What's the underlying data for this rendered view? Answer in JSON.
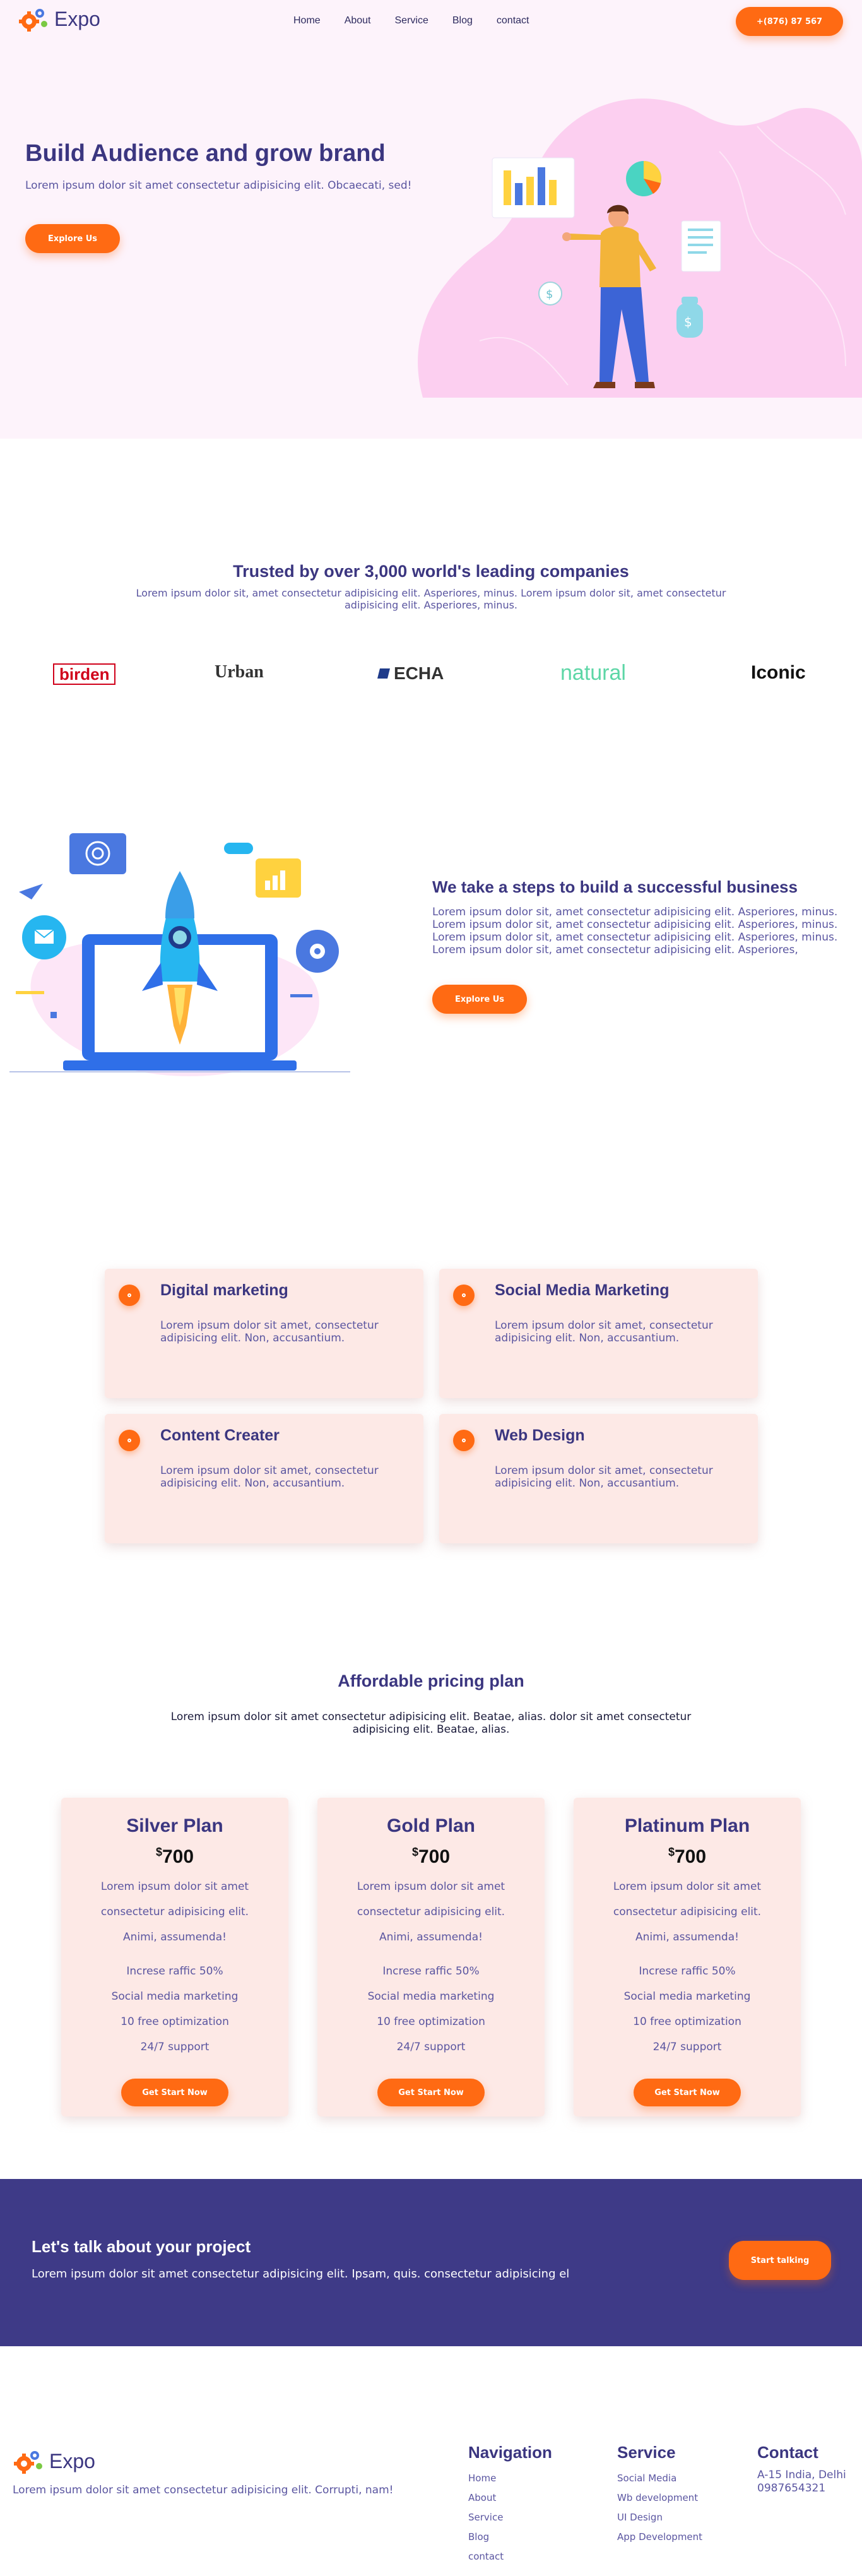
{
  "header": {
    "logo_text": "Expo",
    "nav": [
      "Home",
      "About",
      "Service",
      "Blog",
      "contact"
    ],
    "phone": "+(876) 87 567"
  },
  "hero": {
    "title": "Build Audience and grow brand",
    "subtitle": "Lorem ipsum dolor sit amet consectetur adipisicing elit. Obcaecati, sed!",
    "button": "Explore Us"
  },
  "trusted": {
    "title": "Trusted by over 3,000 world's leading companies",
    "subtitle": "Lorem ipsum dolor sit, amet consectetur adipisicing elit. Asperiores, minus. Lorem ipsum dolor sit, amet consectetur adipisicing elit. Asperiores, minus.",
    "brands": [
      "birden",
      "Urban",
      "ECHA",
      "natural",
      "Iconic"
    ]
  },
  "steps": {
    "title": "We take a steps to build a successful business",
    "text": "Lorem ipsum dolor sit, amet consectetur adipisicing elit. Asperiores, minus. Lorem ipsum dolor sit, amet consectetur adipisicing elit. Asperiores, minus. Lorem ipsum dolor sit, amet consectetur adipisicing elit. Asperiores, minus. Lorem ipsum dolor sit, amet consectetur adipisicing elit. Asperiores,",
    "button": "Explore Us"
  },
  "services": [
    {
      "title": "Digital marketing",
      "text": "Lorem ipsum dolor sit amet, consectetur adipisicing elit. Non, accusantium."
    },
    {
      "title": "Social Media Marketing",
      "text": "Lorem ipsum dolor sit amet, consectetur adipisicing elit. Non, accusantium."
    },
    {
      "title": "Content Creater",
      "text": "Lorem ipsum dolor sit amet, consectetur adipisicing elit. Non, accusantium."
    },
    {
      "title": "Web Design",
      "text": "Lorem ipsum dolor sit amet, consectetur adipisicing elit. Non, accusantium."
    }
  ],
  "pricing": {
    "title": "Affordable pricing plan",
    "subtitle": "Lorem ipsum dolor sit amet consectetur adipisicing elit. Beatae, alias. dolor sit amet consectetur adipisicing elit. Beatae, alias.",
    "plans": [
      {
        "name": "Silver Plan",
        "currency": "$",
        "price": "700",
        "desc": "Lorem ipsum dolor sit amet consectetur adipisicing elit. Animi, assumenda!",
        "features": [
          "Increse raffic 50%",
          "Social media marketing",
          "10 free optimization",
          "24/7 support"
        ],
        "button": "Get Start Now"
      },
      {
        "name": "Gold Plan",
        "currency": "$",
        "price": "700",
        "desc": "Lorem ipsum dolor sit amet consectetur adipisicing elit. Animi, assumenda!",
        "features": [
          "Increse raffic 50%",
          "Social media marketing",
          "10 free optimization",
          "24/7 support"
        ],
        "button": "Get Start Now"
      },
      {
        "name": "Platinum Plan",
        "currency": "$",
        "price": "700",
        "desc": "Lorem ipsum dolor sit amet consectetur adipisicing elit. Animi, assumenda!",
        "features": [
          "Increse raffic 50%",
          "Social media marketing",
          "10 free optimization",
          "24/7 support"
        ],
        "button": "Get Start Now"
      }
    ]
  },
  "cta": {
    "title": "Let's talk about your project",
    "text": "Lorem ipsum dolor sit amet consectetur adipisicing elit. Ipsam, quis. consectetur adipisicing el",
    "button": "Start talking"
  },
  "footer": {
    "logo_text": "Expo",
    "tagline": "Lorem ipsum dolor sit amet consectetur adipisicing elit. Corrupti, nam!",
    "navigation": {
      "title": "Navigation",
      "items": [
        "Home",
        "About",
        "Service",
        "Blog",
        "contact"
      ]
    },
    "service": {
      "title": "Service",
      "items": [
        "Social Media",
        "Wb development",
        "UI Design",
        "App Development"
      ]
    },
    "contact": {
      "title": "Contact",
      "address": "A-15 India, Delhi",
      "phone": "0987654321"
    }
  },
  "colors": {
    "accent": "#ff6a13",
    "navy": "#3b3680",
    "hero_bg": "#fdf3fb",
    "card_bg": "#fde9e6",
    "cta_bg": "#3e3a87"
  }
}
